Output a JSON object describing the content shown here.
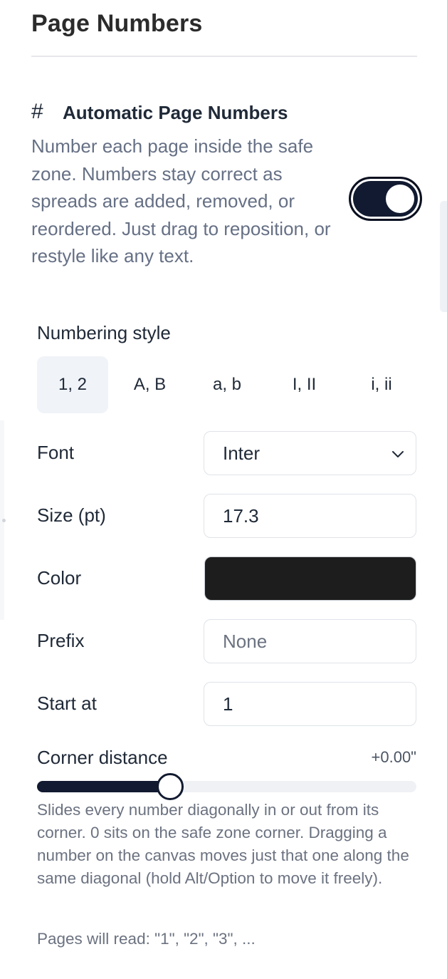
{
  "header": {
    "title": "Page Numbers"
  },
  "section": {
    "icon": "hash-icon",
    "icon_glyph": "#",
    "title": "Automatic Page Numbers",
    "description": "Number each page inside the safe zone. Numbers stay correct as spreads are added, removed, or reordered. Just drag to reposition, or restyle like any text.",
    "enabled": true
  },
  "numbering": {
    "label": "Numbering style",
    "options": [
      "1, 2",
      "A, B",
      "a, b",
      "I, II",
      "i, ii"
    ],
    "selected": "1, 2"
  },
  "font": {
    "label": "Font",
    "value": "Inter"
  },
  "size": {
    "label": "Size (pt)",
    "value": "17.3"
  },
  "color": {
    "label": "Color",
    "value": "#1d1d1d"
  },
  "prefix": {
    "label": "Prefix",
    "value": "",
    "placeholder": "None"
  },
  "start": {
    "label": "Start at",
    "value": "1"
  },
  "corner": {
    "label": "Corner distance",
    "value_text": "+0.00\"",
    "slider_fraction": 0.35,
    "help": "Slides every number diagonally in or out from its corner. 0 sits on the safe zone corner. Dragging a number on the canvas moves just that one along the same diagonal (hold Alt/Option to move it freely)."
  },
  "preview": "Pages will read: \"1\", \"2\", \"3\", ...",
  "colors": {
    "accent": "#111a30",
    "muted_text": "#667085",
    "border": "#dfe3e8"
  }
}
